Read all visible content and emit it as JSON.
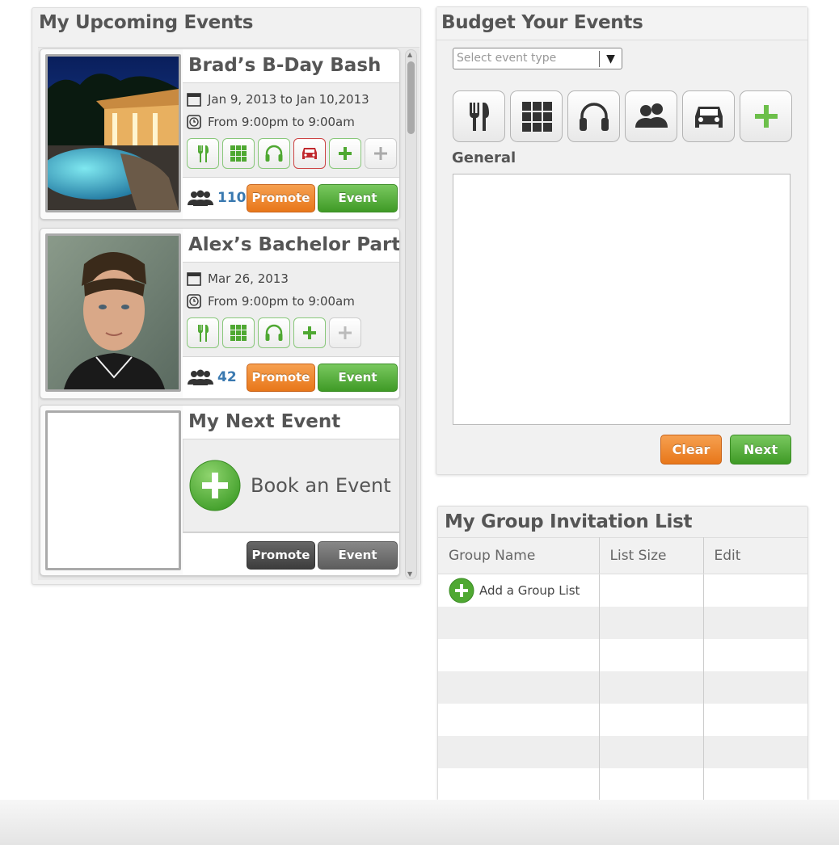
{
  "upcoming": {
    "title": "My Upcoming Events",
    "events": [
      {
        "title": "Brad’s B-Day Bash",
        "date": "Jan 9, 2013 to Jan 10,2013",
        "time": "From 9:00pm to 9:00am",
        "guests": "110",
        "promote": "Promote",
        "stats": "Event Stats",
        "service_icons": [
          "fork-knife-icon",
          "grid-icon",
          "headphones-icon",
          "car-icon",
          "plus-icon",
          "plus-icon"
        ]
      },
      {
        "title": "Alex’s Bachelor Party",
        "date": "Mar 26, 2013",
        "time": "From 9:00pm to 9:00am",
        "guests": "42",
        "promote": "Promote",
        "stats": "Event Stats",
        "service_icons": [
          "fork-knife-icon",
          "grid-icon",
          "headphones-icon",
          "plus-icon",
          "plus-icon"
        ]
      }
    ],
    "next": {
      "title": "My Next Event",
      "book_label": "Book an Event",
      "promote": "Promote",
      "stats": "Event Stats"
    }
  },
  "budget": {
    "title": "Budget Your Events",
    "select_placeholder": "Select event type",
    "icons": [
      "fork-knife-icon",
      "grid-icon",
      "headphones-icon",
      "people-icon",
      "car-icon",
      "plus-icon"
    ],
    "section_label": "General",
    "clear_label": "Clear",
    "next_label": "Next"
  },
  "groups": {
    "title": "My Group Invitation List",
    "columns": [
      "Group Name",
      "List Size",
      "Edit"
    ],
    "add_label": "Add a Group List"
  },
  "colors": {
    "accent_green": "#4fa832",
    "accent_orange": "#ee8423",
    "guest_count_blue": "#3a79b0",
    "car_red": "#c0282d"
  }
}
